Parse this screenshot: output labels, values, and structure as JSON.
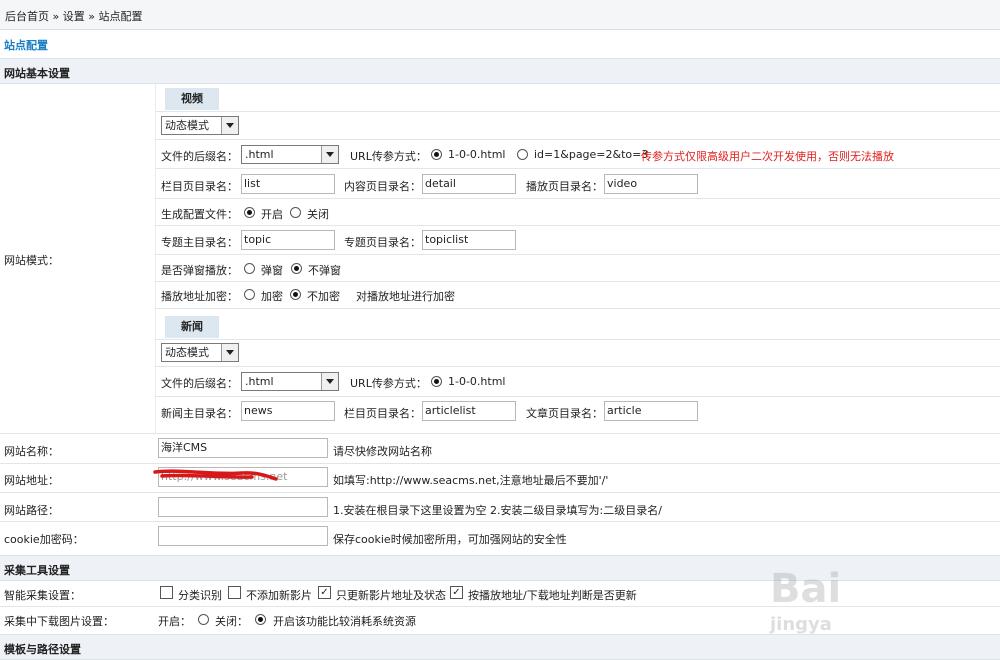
{
  "breadcrumb": "后台首页 » 设置 » 站点配置",
  "page_title": "站点配置",
  "sections": {
    "basic": "网站基本设置",
    "collect": "采集工具设置",
    "template": "模板与路径设置"
  },
  "site_mode_label": "网站模式：",
  "video": {
    "tab": "视频",
    "mode_select": "动态模式",
    "suffix_label": "文件的后缀名：",
    "suffix_value": ".html",
    "url_param_label": "URL传参方式：",
    "url_option1": "1-0-0.html",
    "url_option2": "id=1&page=2&to=3",
    "url_warning": "传参方式仅限高级用户二次开发使用，否则无法播放",
    "column_dir_label": "栏目页目录名：",
    "column_dir_value": "list",
    "content_dir_label": "内容页目录名：",
    "content_dir_value": "detail",
    "play_dir_label": "播放页目录名：",
    "play_dir_value": "video",
    "gen_config_label": "生成配置文件：",
    "gen_on": "开启",
    "gen_off": "关闭",
    "topic_main_label": "专题主目录名：",
    "topic_main_value": "topic",
    "topic_page_label": "专题页目录名：",
    "topic_page_value": "topiclist",
    "popup_label": "是否弹窗播放：",
    "popup_yes": "弹窗",
    "popup_no": "不弹窗",
    "encrypt_label": "播放地址加密：",
    "encrypt_yes": "加密",
    "encrypt_no": "不加密",
    "encrypt_hint": "对播放地址进行加密"
  },
  "news": {
    "tab": "新闻",
    "mode_select": "动态模式",
    "suffix_label": "文件的后缀名：",
    "suffix_value": ".html",
    "url_param_label": "URL传参方式：",
    "url_option1": "1-0-0.html",
    "news_main_label": "新闻主目录名：",
    "news_main_value": "news",
    "column_dir_label": "栏目页目录名：",
    "column_dir_value": "articlelist",
    "article_dir_label": "文章页目录名：",
    "article_dir_value": "article"
  },
  "site_name": {
    "label": "网站名称：",
    "value": "海洋CMS",
    "hint": "请尽快修改网站名称"
  },
  "site_url": {
    "label": "网站地址：",
    "value": "http://www.seacms.net",
    "hint": "如填写:http://www.seacms.net,注意地址最后不要加'/'"
  },
  "site_path": {
    "label": "网站路径：",
    "value": "",
    "hint": "1.安装在根目录下这里设置为空 2.安装二级目录填写为:二级目录名/"
  },
  "cookie": {
    "label": "cookie加密码：",
    "value": "",
    "hint": "保存cookie时候加密所用，可加强网站的安全性"
  },
  "smart_collect": {
    "label": "智能采集设置：",
    "opt1": "分类识别",
    "opt2": "不添加新影片",
    "opt3": "只更新影片地址及状态",
    "opt4": "按播放地址/下载地址判断是否更新"
  },
  "collect_img": {
    "label": "采集中下载图片设置：",
    "on": "开启：",
    "off": "关闭：",
    "hint": "开启该功能比较消耗系统资源"
  },
  "watermark": {
    "line1": "Bai",
    "line2": "jingya"
  },
  "colors": {
    "accent": "#1a7fc4",
    "warning": "#e02020",
    "section_bg": "#eef2f6"
  }
}
